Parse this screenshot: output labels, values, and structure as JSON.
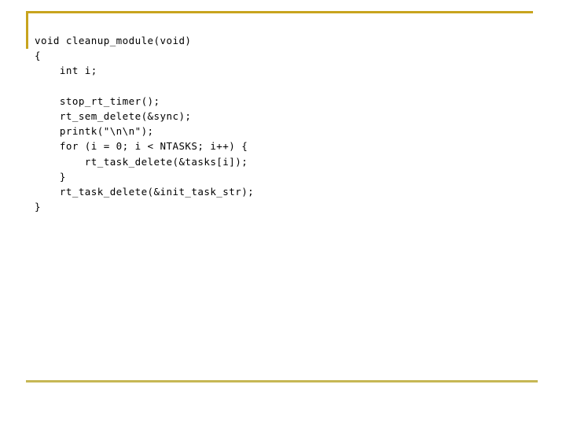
{
  "slide": {
    "type": "code-listing-slide",
    "background_color": "#ffffff",
    "decor": {
      "rule_top_color": "#c8a41e",
      "rule_bottom_color": "#c6b755"
    }
  },
  "code": {
    "language": "c",
    "function_name": "cleanup_module",
    "text_color": "#000000",
    "lines": [
      "void cleanup_module(void)",
      "{",
      "    int i;",
      "",
      "    stop_rt_timer();",
      "    rt_sem_delete(&sync);",
      "    printk(\"\\n\\n\");",
      "    for (i = 0; i < NTASKS; i++) {",
      "        rt_task_delete(&tasks[i]);",
      "    }",
      "    rt_task_delete(&init_task_str);",
      "}"
    ]
  }
}
